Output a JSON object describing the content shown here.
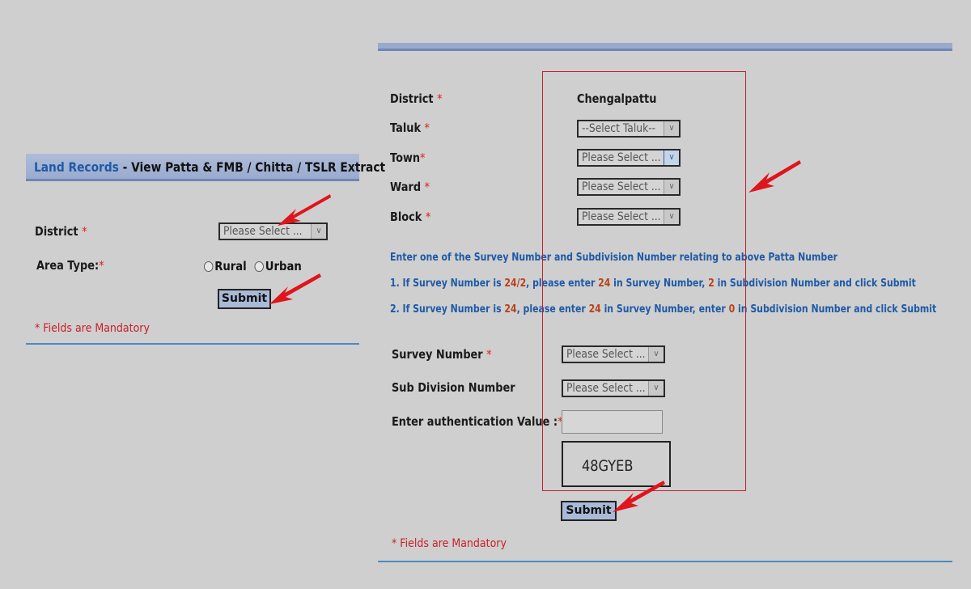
{
  "left_panel": {
    "header": {
      "link_text": "Land Records",
      "title_text": " - View Patta & FMB / Chitta / TSLR Extract"
    },
    "district_label": "District",
    "district_select": "Please Select ...",
    "area_type_label": "Area Type:",
    "area_type_options": [
      "Rural",
      "Urban"
    ],
    "submit_label": "Submit",
    "mandatory_note": "* Fields are Mandatory"
  },
  "right_panel": {
    "district_label": "District",
    "district_value": "Chengalpattu",
    "taluk_label": "Taluk",
    "taluk_select": "--Select Taluk--",
    "town_label": "Town",
    "town_select": "Please Select ...",
    "ward_label": "Ward",
    "ward_select": "Please Select ...",
    "block_label": "Block",
    "block_select": "Please Select ...",
    "instructions": {
      "intro": "Enter one of the Survey Number and Subdivision Number relating to above Patta Number",
      "line1": {
        "a": "1. If Survey Number is ",
        "v1": "24/2",
        "b": ", please enter ",
        "v2": "24",
        "c": " in Survey Number, ",
        "v3": "2",
        "d": " in Subdivision Number and click Submit"
      },
      "line2": {
        "a": "2. If Survey Number is ",
        "v1": "24",
        "b": ", please enter ",
        "v2": "24",
        "c": " in Survey Number, enter ",
        "v3": "0",
        "d": " in Subdivision Number and click Submit"
      }
    },
    "survey_label": "Survey Number",
    "survey_select": "Please Select ...",
    "subdiv_label": "Sub Division Number",
    "subdiv_select": "Please Select ...",
    "auth_label": "Enter authentication Value :",
    "auth_value": "",
    "captcha": "48GYEB",
    "submit_label": "Submit",
    "mandatory_note": "* Fields are Mandatory"
  },
  "required_marker": "*",
  "colors": {
    "accent_blue": "#1f5aa6",
    "required_red": "#c9202a",
    "arrow_red": "#e0141c",
    "button_bg": "#a9b9d8"
  }
}
